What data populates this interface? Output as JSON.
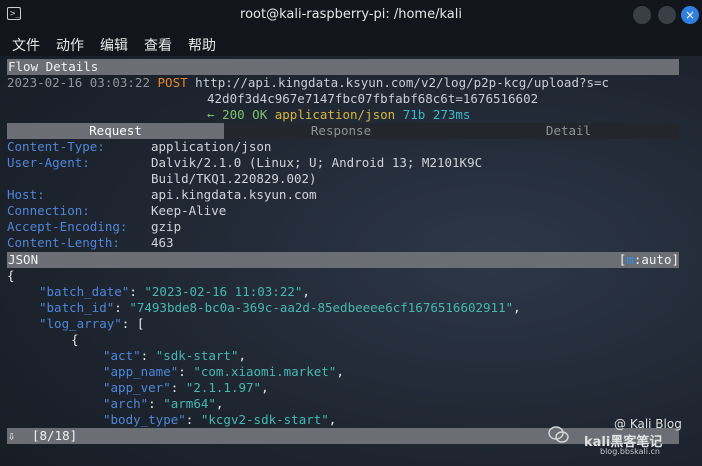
{
  "window": {
    "title": "root@kali-raspberry-pi: /home/kali",
    "app_icon": "terminal-icon",
    "close_glyph": "×"
  },
  "menu": [
    "文件",
    "动作",
    "编辑",
    "查看",
    "帮助"
  ],
  "flow": {
    "header": "Flow Details",
    "timestamp": "2023-02-16 03:03:22",
    "method": "POST",
    "url_line1": "http://api.kingdata.ksyun.com/v2/log/p2p-kcg/upload?s=c",
    "url_line2": "42d0f3d4c967e7147fbc07fbfabf68c6t=1676516602",
    "resp_arrow": "←",
    "resp_status": "200 OK",
    "resp_type": "application/json",
    "resp_size": "71b",
    "resp_time": "273ms"
  },
  "tabs": {
    "request": "Request",
    "response": "Response",
    "detail": "Detail"
  },
  "headers": [
    {
      "key": "Content-Type:",
      "value": "application/json"
    },
    {
      "key": "User-Agent:",
      "value": "Dalvik/2.1.0 (Linux; U; Android 13; M2101K9C",
      "value2": "Build/TKQ1.220829.002)"
    },
    {
      "key": "Host:",
      "value": "api.kingdata.ksyun.com"
    },
    {
      "key": "Connection:",
      "value": "Keep-Alive"
    },
    {
      "key": "Accept-Encoding:",
      "value": "gzip"
    },
    {
      "key": "Content-Length:",
      "value": "463"
    }
  ],
  "json_bar": {
    "label": "JSON",
    "mode_open": "[",
    "mode_key": "m",
    "mode_rest": ":auto]"
  },
  "json_lines": {
    "l0": "{",
    "batch_date_key": "\"batch_date\"",
    "batch_date_val": "\"2023-02-16 11:03:22\"",
    "batch_id_key": "\"batch_id\"",
    "batch_id_val": "\"7493bde8-bc0a-369c-aa2d-85edbeeee6cf1676516602911\"",
    "log_array_key": "\"log_array\"",
    "log_array_open": "[",
    "obj_open": "{",
    "act_key": "\"act\"",
    "act_val": "\"sdk-start\"",
    "app_name_key": "\"app_name\"",
    "app_name_val": "\"com.xiaomi.market\"",
    "app_ver_key": "\"app_ver\"",
    "app_ver_val": "\"2.1.1.97\"",
    "arch_key": "\"arch\"",
    "arch_val": "\"arm64\"",
    "body_type_key": "\"body_type\"",
    "body_type_val": "\"kcgv2-sdk-start\""
  },
  "status_bar": {
    "arrow": "⇩",
    "position": "[8/18]"
  },
  "watermark": {
    "line1": "@ Kali Blog",
    "line2": "kali黑客笔记",
    "line3": "blog.bbskali.cn"
  }
}
